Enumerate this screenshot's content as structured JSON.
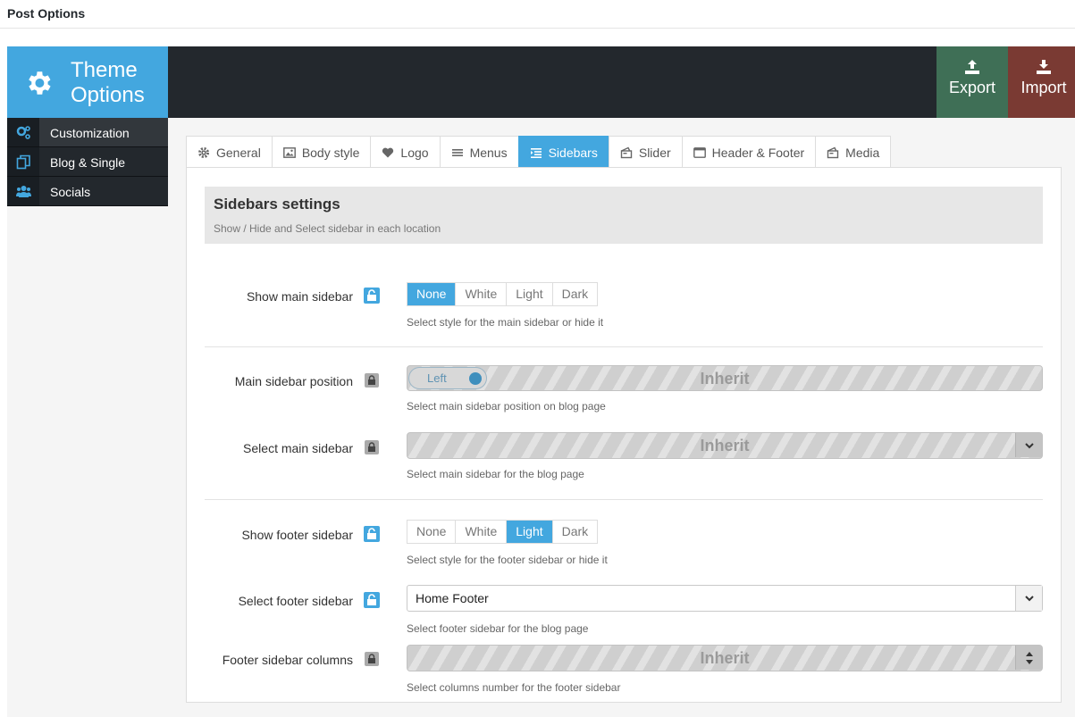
{
  "page_title": "Post Options",
  "brand": {
    "line1": "Theme",
    "line2": "Options"
  },
  "header_buttons": {
    "export": "Export",
    "import": "Import"
  },
  "sidebar": {
    "items": [
      {
        "label": "Customization",
        "icon": "gears-icon"
      },
      {
        "label": "Blog & Single",
        "icon": "copy-icon"
      },
      {
        "label": "Socials",
        "icon": "users-icon"
      }
    ]
  },
  "tabs": [
    {
      "label": "General",
      "icon": "gear-icon"
    },
    {
      "label": "Body style",
      "icon": "image-icon"
    },
    {
      "label": "Logo",
      "icon": "heart-icon"
    },
    {
      "label": "Menus",
      "icon": "menu-icon"
    },
    {
      "label": "Sidebars",
      "icon": "list-icon"
    },
    {
      "label": "Slider",
      "icon": "slider-icon"
    },
    {
      "label": "Header & Footer",
      "icon": "window-icon"
    },
    {
      "label": "Media",
      "icon": "media-icon"
    }
  ],
  "active_tab": "Sidebars",
  "section": {
    "title": "Sidebars settings",
    "subtitle": "Show / Hide and Select sidebar in each location"
  },
  "fields": {
    "show_main_sidebar": {
      "label": "Show main sidebar",
      "options": [
        "None",
        "White",
        "Light",
        "Dark"
      ],
      "selected": "None",
      "desc": "Select style for the main sidebar or hide it"
    },
    "main_sidebar_position": {
      "label": "Main sidebar position",
      "toggle_label": "Left",
      "value": "Inherit",
      "desc": "Select main sidebar position on blog page"
    },
    "select_main_sidebar": {
      "label": "Select main sidebar",
      "value": "Inherit",
      "desc": "Select main sidebar for the blog page"
    },
    "show_footer_sidebar": {
      "label": "Show footer sidebar",
      "options": [
        "None",
        "White",
        "Light",
        "Dark"
      ],
      "selected": "Light",
      "desc": "Select style for the footer sidebar or hide it"
    },
    "select_footer_sidebar": {
      "label": "Select footer sidebar",
      "value": "Home Footer",
      "desc": "Select footer sidebar for the blog page"
    },
    "footer_sidebar_columns": {
      "label": "Footer sidebar columns",
      "value": "Inherit",
      "desc": "Select columns number for the footer sidebar"
    }
  },
  "colors": {
    "accent": "#43a7df",
    "header": "#23282d",
    "export": "#3f6f56",
    "import": "#7a3a33"
  }
}
